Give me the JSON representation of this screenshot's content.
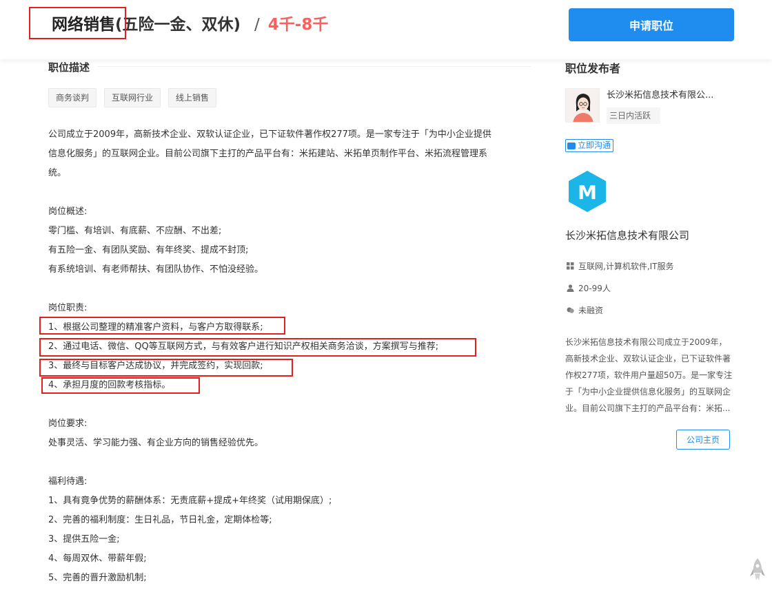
{
  "job": {
    "title": "网络销售",
    "subtitle": "(五险一金、双休)",
    "separator": "/",
    "salary": "4千-8千",
    "apply_label": "申请职位"
  },
  "description": {
    "section_title": "职位描述",
    "tags": [
      "商务谈判",
      "互联网行业",
      "线上销售"
    ],
    "intro": [
      "公司成立于2009年，高新技术企业、双软认证企业，已下证软件著作权277项。是一家专注于「为中小企业提供",
      "信息化服务」的互联网企业。目前公司旗下主打的产品平台有：米拓建站、米拓单页制作平台、米拓流程管理系",
      "统。"
    ],
    "overview_title": "岗位概述:",
    "overview": [
      "零门槛、有培训、有底薪、不应酬、不出差;",
      "有五险一金、有团队奖励、有年终奖、提成不封顶;",
      "有系统培训、有老师帮扶、有团队协作、不怕没经验。"
    ],
    "duties_title": "岗位职责:",
    "duties": [
      "1、根据公司整理的精准客户资料，与客户方取得联系;",
      "2、通过电话、微信、QQ等互联网方式，与有效客户进行知识产权相关商务洽谈，方案撰写与推荐;",
      "3、最终与目标客户达成协议，并完成签约，实现回款;",
      "4、承担月度的回款考核指标。"
    ],
    "requirements_title": "岗位要求:",
    "requirements": [
      "处事灵活、学习能力强、有企业方向的销售经验优先。"
    ],
    "benefits_title": "福利待遇:",
    "benefits": [
      "1、具有竟争优势的薪酬体系：无责底薪+提成+年终奖（试用期保底）;",
      "2、完善的福利制度：生日礼品，节日礼金，定期体检等;",
      "3、提供五险一金;",
      "4、每周双休、带薪年假;",
      "5、完善的晋升激励机制;"
    ]
  },
  "publisher": {
    "section_title": "职位发布者",
    "company": "长沙米拓信息技术有限公...",
    "active": "三日内活跃",
    "chat_label": "立即沟通"
  },
  "company": {
    "logo_letter": "M",
    "name": "长沙米拓信息技术有限公司",
    "industry": "互联网,计算机软件,IT服务",
    "size": "20-99人",
    "funding": "未融资",
    "description": "长沙米拓信息技术有限公司成立于2009年，高新技术企业、双软认证企业，已下证软件著作权277项，软件用户量超50万。是一家专注于「为中小企业提供信息化服务」的互联网企业。目前公司旗下主打的产品平台有：米拓...",
    "homepage_label": "公司主页"
  },
  "colors": {
    "accent": "#1f8cf0",
    "salary": "#fd5f5f",
    "highlight": "#e0201c",
    "logo": "#1cb5e8"
  },
  "icons": [
    "industry-icon",
    "people-icon",
    "funding-icon",
    "chat-icon",
    "rocket-icon"
  ]
}
